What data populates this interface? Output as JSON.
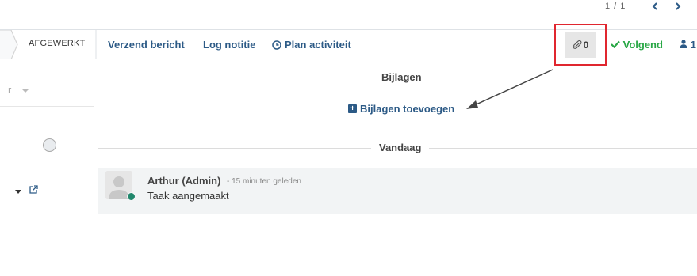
{
  "pager": {
    "text": "1 / 1"
  },
  "stage": {
    "current": "AFGEWERKT"
  },
  "left_form": {
    "field_placeholder": "r"
  },
  "chatter": {
    "send_message": "Verzend bericht",
    "log_note": "Log notitie",
    "plan_activity": "Plan activiteit",
    "attachments_count": "0",
    "follow_label": "Volgend",
    "followers_count": "1",
    "attachments_header": "Bijlagen",
    "add_attachments": "Bijlagen toevoegen",
    "today_header": "Vandaag"
  },
  "message": {
    "author": "Arthur (Admin)",
    "time": "- 15 minuten geleden",
    "body": "Taak aangemaakt"
  },
  "colors": {
    "link_blue": "#2c5a86",
    "follow_green": "#28a745",
    "highlight_red": "#e0262f",
    "online_teal": "#21876c"
  },
  "icons": [
    "chevron-left-icon",
    "chevron-right-icon",
    "paperclip-icon",
    "check-icon",
    "clock-icon",
    "user-icon",
    "plus-square-icon",
    "external-link-icon",
    "caret-down-icon"
  ]
}
